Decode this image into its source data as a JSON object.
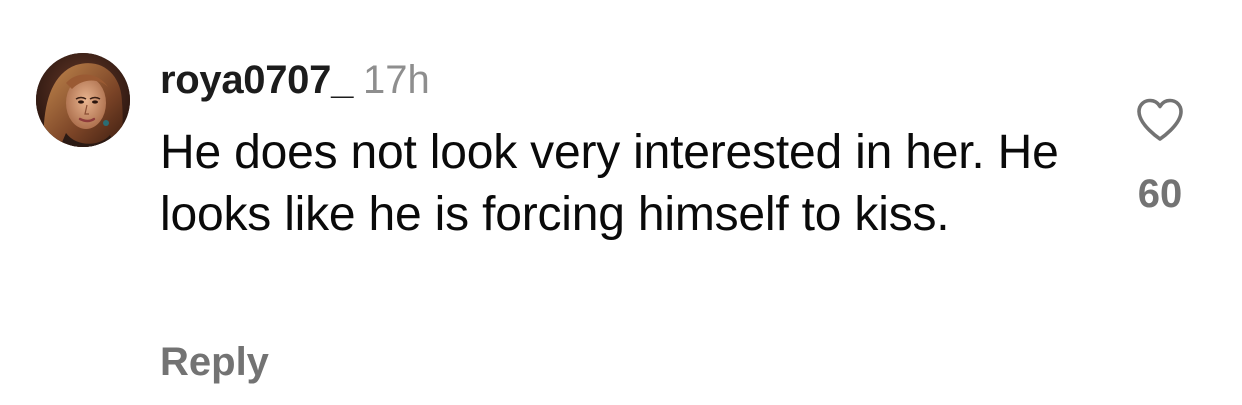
{
  "comment": {
    "username": "roya0707_",
    "time_ago": "17h",
    "text": "He does not look very interested in her. He looks like he is forcing himself to kiss.",
    "reply_label": "Reply",
    "like_count": "60",
    "avatar": "profile-photo",
    "like_icon": "heart-outline-icon"
  },
  "colors": {
    "text": "#0a0a0a",
    "username": "#1c1c1c",
    "secondary": "#8e8e8e",
    "action": "#737373",
    "background": "#ffffff"
  }
}
